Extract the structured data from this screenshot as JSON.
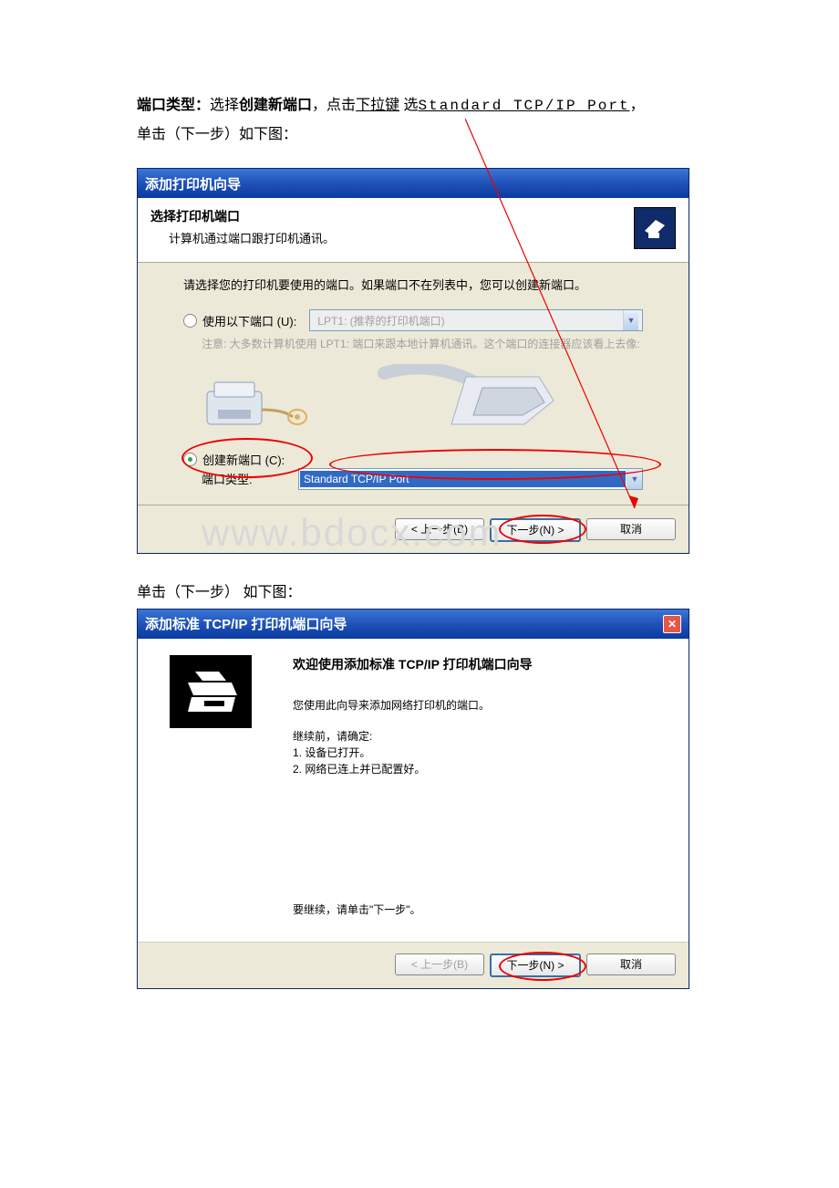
{
  "intro": {
    "label": "端口类型：",
    "text1": "选择",
    "bold": "创建新端口",
    "text2": "，点击",
    "underlined": "下拉键",
    "text3": " 选",
    "mono": "Standard TCP/IP Port",
    "text4": "，",
    "line2": "单击（下一步）如下图："
  },
  "dialog1": {
    "title": "添加打印机向导",
    "header_title": "选择打印机端口",
    "header_sub": "计算机通过端口跟打印机通讯。",
    "body_instr": "请选择您的打印机要使用的端口。如果端口不在列表中，您可以创建新端口。",
    "radio_use_label": "使用以下端口 (U):",
    "dropdown1_value": "LPT1: (推荐的打印机端口)",
    "note": "注意: 大多数计算机使用 LPT1: 端口来跟本地计算机通讯。这个端口的连接器应该看上去像:",
    "radio_create_label": "创建新端口 (C):",
    "port_type_label": "端口类型:",
    "dropdown2_value": "Standard TCP/IP Port",
    "btn_back": "< 上一步(B)",
    "btn_next": "下一步(N) >",
    "btn_cancel": "取消",
    "watermark": "www.bdocx.com"
  },
  "caption2": "单击（下一步） 如下图：",
  "dialog2": {
    "title": "添加标准 TCP/IP 打印机端口向导",
    "welcome_title": "欢迎使用添加标准 TCP/IP 打印机端口向导",
    "para1": "您使用此向导来添加网络打印机的端口。",
    "para2": "继续前，请确定:\n1.  设备已打开。\n2.  网络已连上并已配置好。",
    "para3": "要继续，请单击\"下一步\"。",
    "btn_back": "< 上一步(B)",
    "btn_next": "下一步(N) >",
    "btn_cancel": "取消"
  }
}
